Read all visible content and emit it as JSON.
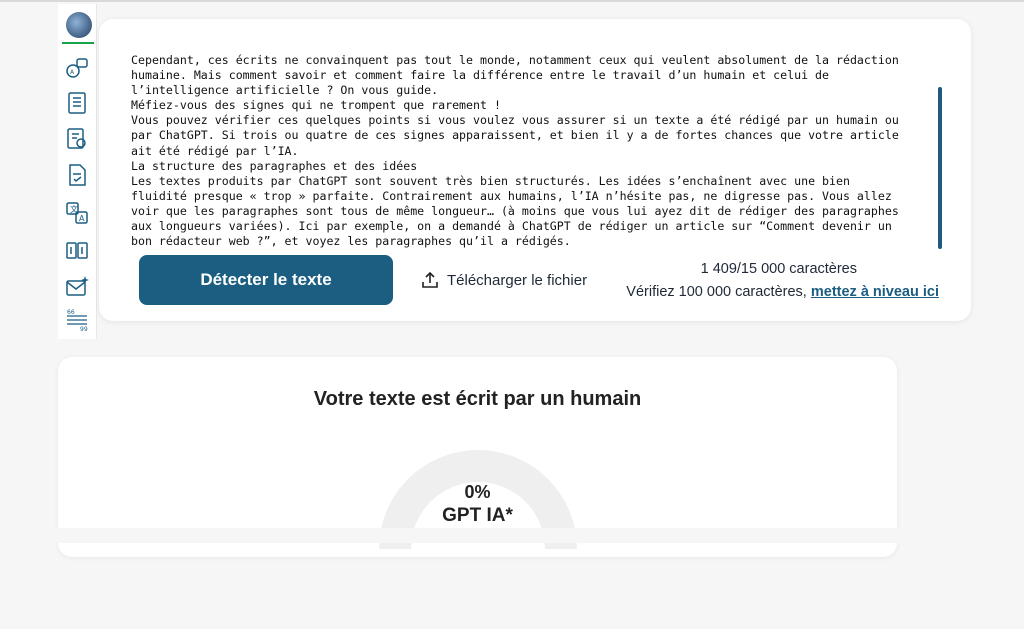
{
  "sidebar": {
    "icons": [
      "brain-logo-icon",
      "translate-icon",
      "document-list-icon",
      "settings-document-icon",
      "checklist-document-icon",
      "language-icon",
      "word-counter-icon",
      "mail-icon",
      "quote-icon"
    ]
  },
  "editor": {
    "text": "Cependant, ces écrits ne convainquent pas tout le monde, notamment ceux qui veulent absolument de la rédaction\nhumaine. Mais comment savoir et comment faire la différence entre le travail d’un humain et celui de\nl’intelligence artificielle ? On vous guide.\nMéfiez-vous des signes qui ne trompent que rarement !\nVous pouvez vérifier ces quelques points si vous voulez vous assurer si un texte a été rédigé par un humain ou\npar ChatGPT. Si trois ou quatre de ces signes apparaissent, et bien il y a de fortes chances que votre article\nait été rédigé par l’IA.\nLa structure des paragraphes et des idées\nLes textes produits par ChatGPT sont souvent très bien structurés. Les idées s’enchaînent avec une bien\nfluidité presque « trop » parfaite. Contrairement aux humains, l’IA n’hésite pas, ne digresse pas. Vous allez\nvoir que les paragraphes sont tous de même longueur… (à moins que vous lui ayez dit de rédiger des paragraphes\naux longueurs variées). Ici par exemple, on a demandé à ChatGPT de rédiger un article sur “Comment devenir un\nbon rédacteur web ?”, et voyez les paragraphes qu’il a rédigés.",
    "detect_button": "Détecter le texte",
    "upload_label": "Télécharger le fichier",
    "char_count": "1 409/15 000 caractères",
    "upgrade_prefix": "Vérifiez 100 000 caractères, ",
    "upgrade_link": "mettez à niveau ici"
  },
  "result": {
    "title": "Votre texte est écrit par un humain",
    "percent": "0%",
    "label": "GPT IA*",
    "ai_fraction": 0
  },
  "colors": {
    "primary": "#1b5e82",
    "gauge_track": "#efefef",
    "accent_green": "#16a34a"
  }
}
